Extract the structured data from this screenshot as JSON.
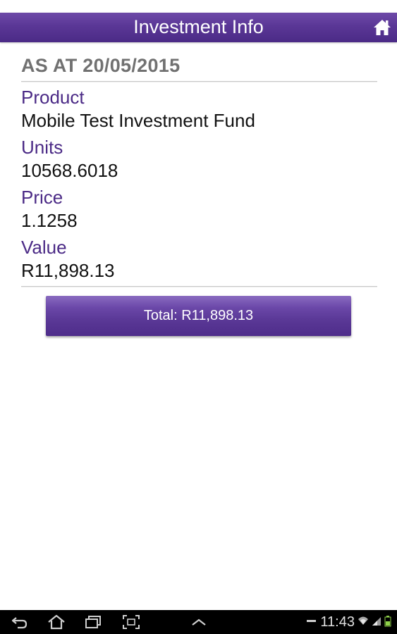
{
  "header": {
    "title": "Investment Info",
    "home_icon": "home-icon"
  },
  "statement": {
    "as_at": "AS AT 20/05/2015"
  },
  "fields": {
    "product_label": "Product",
    "product_value": "Mobile Test Investment Fund",
    "units_label": "Units",
    "units_value": "10568.6018",
    "price_label": "Price",
    "price_value": "1.1258",
    "value_label": "Value",
    "value_value": "R11,898.13"
  },
  "total": {
    "label": "Total: R11,898.13"
  },
  "system_bar": {
    "time": "11:43",
    "icons": [
      "back-icon",
      "home-nav-icon",
      "recent-apps-icon",
      "screenshot-icon",
      "chevron-up-icon",
      "minus-icon",
      "wifi-icon",
      "signal-icon",
      "battery-icon"
    ]
  },
  "colors": {
    "brand": "#5a3796",
    "label": "#4b2a86",
    "heading_gray": "#717171"
  }
}
